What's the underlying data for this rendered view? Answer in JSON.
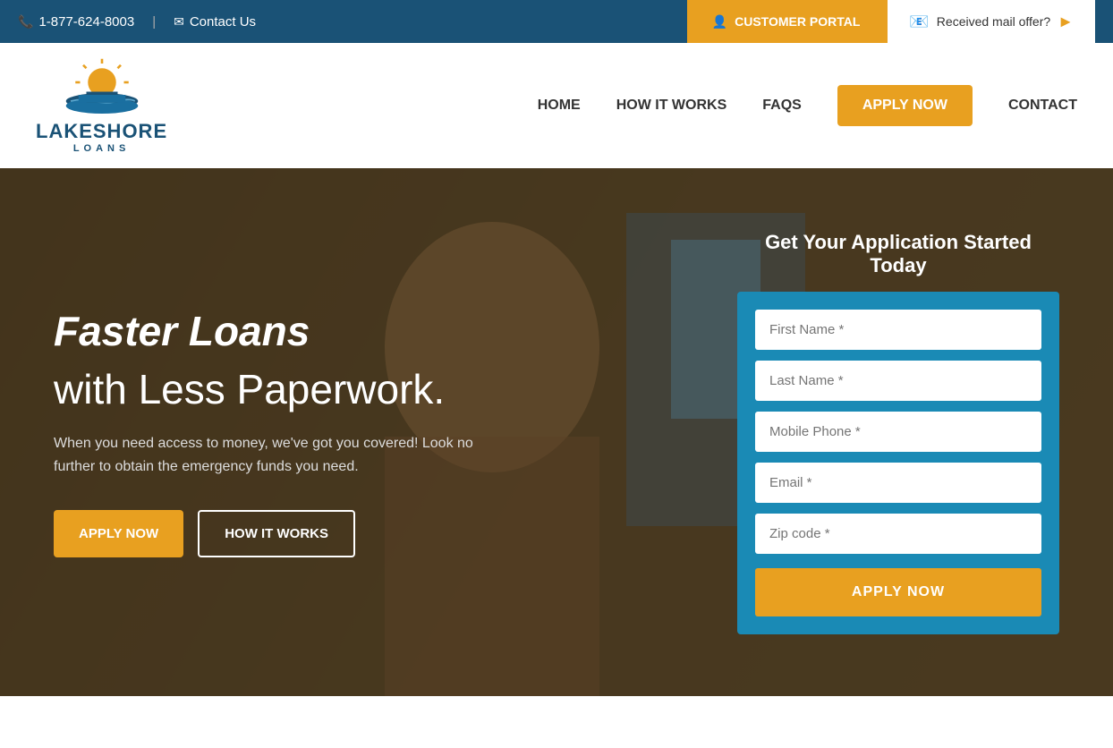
{
  "topbar": {
    "phone": "1-877-624-8003",
    "contact_label": "Contact Us",
    "customer_portal_label": "CUSTOMER PORTAL",
    "mail_offer_label": "Received mail offer?"
  },
  "nav": {
    "home_label": "HOME",
    "how_it_works_label": "HOW IT WORKS",
    "faqs_label": "FAQS",
    "apply_now_label": "APPLY NOW",
    "contact_label": "CONTACT",
    "logo_title": "LAKESHORE",
    "logo_subtitle": "LOANS"
  },
  "hero": {
    "headline": "Faster Loans",
    "subheadline": "with Less Paperwork.",
    "description": "When you need access to money, we've got you covered! Look no further to obtain the emergency funds you need.",
    "apply_btn": "APPLY NOW",
    "how_btn": "HOW IT WORKS"
  },
  "form": {
    "title": "Get Your Application Started Today",
    "first_name_placeholder": "First Name *",
    "last_name_placeholder": "Last Name *",
    "mobile_placeholder": "Mobile Phone *",
    "email_placeholder": "Email *",
    "zip_placeholder": "Zip code *",
    "submit_label": "APPLY NOW"
  }
}
